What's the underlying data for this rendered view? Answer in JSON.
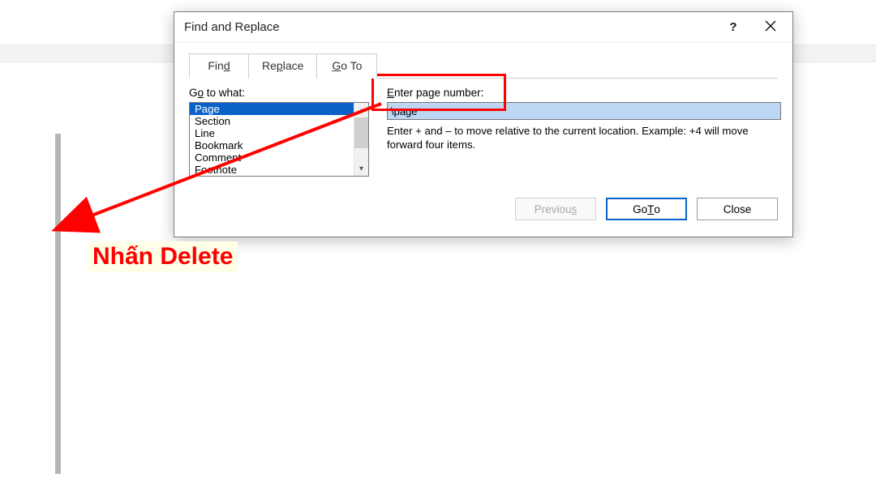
{
  "dialog": {
    "title": "Find and Replace",
    "help_btn": "?",
    "tabs": {
      "find": {
        "prefix": "Fin",
        "u": "d",
        "suffix": ""
      },
      "replace": {
        "prefix": "Re",
        "u": "p",
        "suffix": "lace"
      },
      "goto": {
        "prefix": "",
        "u": "G",
        "suffix": "o To"
      }
    },
    "goto_label_pre": "G",
    "goto_label_u": "o",
    "goto_label_post": " to what:",
    "list": [
      "Page",
      "Section",
      "Line",
      "Bookmark",
      "Comment",
      "Footnote"
    ],
    "enter_label_u": "E",
    "enter_label_post": "nter page number:",
    "input_value": "\\page",
    "help_text": "Enter + and – to move relative to the current location. Example: +4 will move forward four items.",
    "buttons": {
      "prev": {
        "pre": "Previou",
        "u": "s",
        "post": ""
      },
      "goto": {
        "pre": "Go ",
        "u": "T",
        "post": "o"
      },
      "close": "Close"
    }
  },
  "annotation": "Nhấn Delete"
}
